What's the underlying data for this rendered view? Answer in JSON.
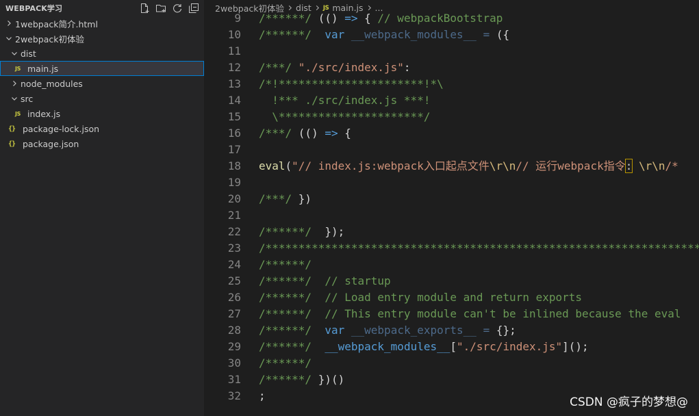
{
  "explorer": {
    "title": "WEBPACK学习",
    "actions": [
      "new-file",
      "new-folder",
      "refresh",
      "collapse-all"
    ],
    "items": [
      {
        "label": "1webpack简介.html",
        "depth": 0,
        "type": "file",
        "chevron": "right"
      },
      {
        "label": "2webpack初体验",
        "depth": 0,
        "type": "folder",
        "chevron": "down"
      },
      {
        "label": "dist",
        "depth": 1,
        "type": "folder",
        "chevron": "down"
      },
      {
        "label": "main.js",
        "depth": 2,
        "type": "js",
        "selected": true
      },
      {
        "label": "node_modules",
        "depth": 1,
        "type": "folder",
        "chevron": "right"
      },
      {
        "label": "src",
        "depth": 1,
        "type": "folder",
        "chevron": "down"
      },
      {
        "label": "index.js",
        "depth": 2,
        "type": "js"
      },
      {
        "label": "package-lock.json",
        "depth": 1,
        "type": "json"
      },
      {
        "label": "package.json",
        "depth": 1,
        "type": "json"
      }
    ]
  },
  "breadcrumb": {
    "folder": "2webpack初体验",
    "sub": "dist",
    "file_icon": "JS",
    "file": "main.js",
    "more": "..."
  },
  "editor": {
    "lines": [
      {
        "n": "9",
        "parts": [
          [
            "c-cm",
            "/******/ "
          ],
          [
            "c-p",
            "(() "
          ],
          [
            "c-kw",
            "=>"
          ],
          [
            "c-p",
            " { "
          ],
          [
            "c-cm",
            "// webpackBootstrap"
          ]
        ]
      },
      {
        "n": "10",
        "parts": [
          [
            "c-cm",
            "/******/ "
          ],
          [
            "c-p",
            " "
          ],
          [
            "c-kw",
            "var"
          ],
          [
            "c-p",
            " "
          ],
          [
            "c-var",
            "__webpack_modules__"
          ],
          [
            "c-p",
            " "
          ],
          [
            "c-var",
            "="
          ],
          [
            "c-p",
            " ({"
          ]
        ]
      },
      {
        "n": "11",
        "parts": []
      },
      {
        "n": "12",
        "parts": [
          [
            "c-cm",
            "/***/ "
          ],
          [
            "c-str",
            "\"./src/index.js\""
          ],
          [
            "c-p",
            ":"
          ]
        ]
      },
      {
        "n": "13",
        "parts": [
          [
            "c-cm",
            "/*!**********************!*\\"
          ]
        ]
      },
      {
        "n": "14",
        "parts": [
          [
            "c-cm",
            "  !*** ./src/index.js ***!"
          ]
        ]
      },
      {
        "n": "15",
        "parts": [
          [
            "c-cm",
            "  \\**********************/"
          ]
        ]
      },
      {
        "n": "16",
        "parts": [
          [
            "c-cm",
            "/***/ "
          ],
          [
            "c-p",
            "(() "
          ],
          [
            "c-kw",
            "=>"
          ],
          [
            "c-p",
            " {"
          ]
        ]
      },
      {
        "n": "17",
        "parts": []
      },
      {
        "n": "18",
        "parts": [
          [
            "c-fn",
            "eval"
          ],
          [
            "c-p",
            "("
          ],
          [
            "c-str",
            "\"// index.js:webpack入口起点文件"
          ],
          [
            "c-esc",
            "\\r\\n"
          ],
          [
            "c-str",
            "// 运行webpack指令"
          ],
          [
            "c-box",
            ":"
          ],
          [
            "c-str",
            " "
          ],
          [
            "c-esc",
            "\\r\\n"
          ],
          [
            "c-str",
            "/*"
          ]
        ]
      },
      {
        "n": "19",
        "parts": []
      },
      {
        "n": "20",
        "parts": [
          [
            "c-cm",
            "/***/ "
          ],
          [
            "c-p",
            "})"
          ]
        ]
      },
      {
        "n": "21",
        "parts": []
      },
      {
        "n": "22",
        "parts": [
          [
            "c-cm",
            "/******/ "
          ],
          [
            "c-p",
            " });"
          ]
        ]
      },
      {
        "n": "23",
        "parts": [
          [
            "c-cm",
            "/************************************************************************"
          ]
        ]
      },
      {
        "n": "24",
        "parts": [
          [
            "c-cm",
            "/******/"
          ]
        ]
      },
      {
        "n": "25",
        "parts": [
          [
            "c-cm",
            "/******/  // startup"
          ]
        ]
      },
      {
        "n": "26",
        "parts": [
          [
            "c-cm",
            "/******/  // Load entry module and return exports"
          ]
        ]
      },
      {
        "n": "27",
        "parts": [
          [
            "c-cm",
            "/******/  // This entry module can't be inlined because the eval"
          ]
        ]
      },
      {
        "n": "28",
        "parts": [
          [
            "c-cm",
            "/******/ "
          ],
          [
            "c-p",
            " "
          ],
          [
            "c-kw",
            "var"
          ],
          [
            "c-p",
            " "
          ],
          [
            "c-var",
            "__webpack_exports__"
          ],
          [
            "c-p",
            " "
          ],
          [
            "c-var",
            "="
          ],
          [
            "c-p",
            " {};"
          ]
        ]
      },
      {
        "n": "29",
        "parts": [
          [
            "c-cm",
            "/******/ "
          ],
          [
            "c-p",
            " "
          ],
          [
            "c-kw",
            "__webpack_modules__"
          ],
          [
            "c-p",
            "["
          ],
          [
            "c-str",
            "\"./src/index.js\""
          ],
          [
            "c-p",
            "]();"
          ]
        ]
      },
      {
        "n": "30",
        "parts": [
          [
            "c-cm",
            "/******/"
          ]
        ]
      },
      {
        "n": "31",
        "parts": [
          [
            "c-cm",
            "/******/ "
          ],
          [
            "c-p",
            "})()"
          ]
        ]
      },
      {
        "n": "32",
        "parts": [
          [
            "c-p",
            ";"
          ]
        ]
      }
    ]
  },
  "watermark": "CSDN @疯子的梦想@",
  "colors": {
    "sidebar_bg": "#252526",
    "editor_bg": "#1e1e1e",
    "selection_outline": "#007fd4",
    "comment": "#6a9955",
    "keyword": "#569cd6",
    "string": "#ce9178",
    "function": "#dcdcaa"
  }
}
